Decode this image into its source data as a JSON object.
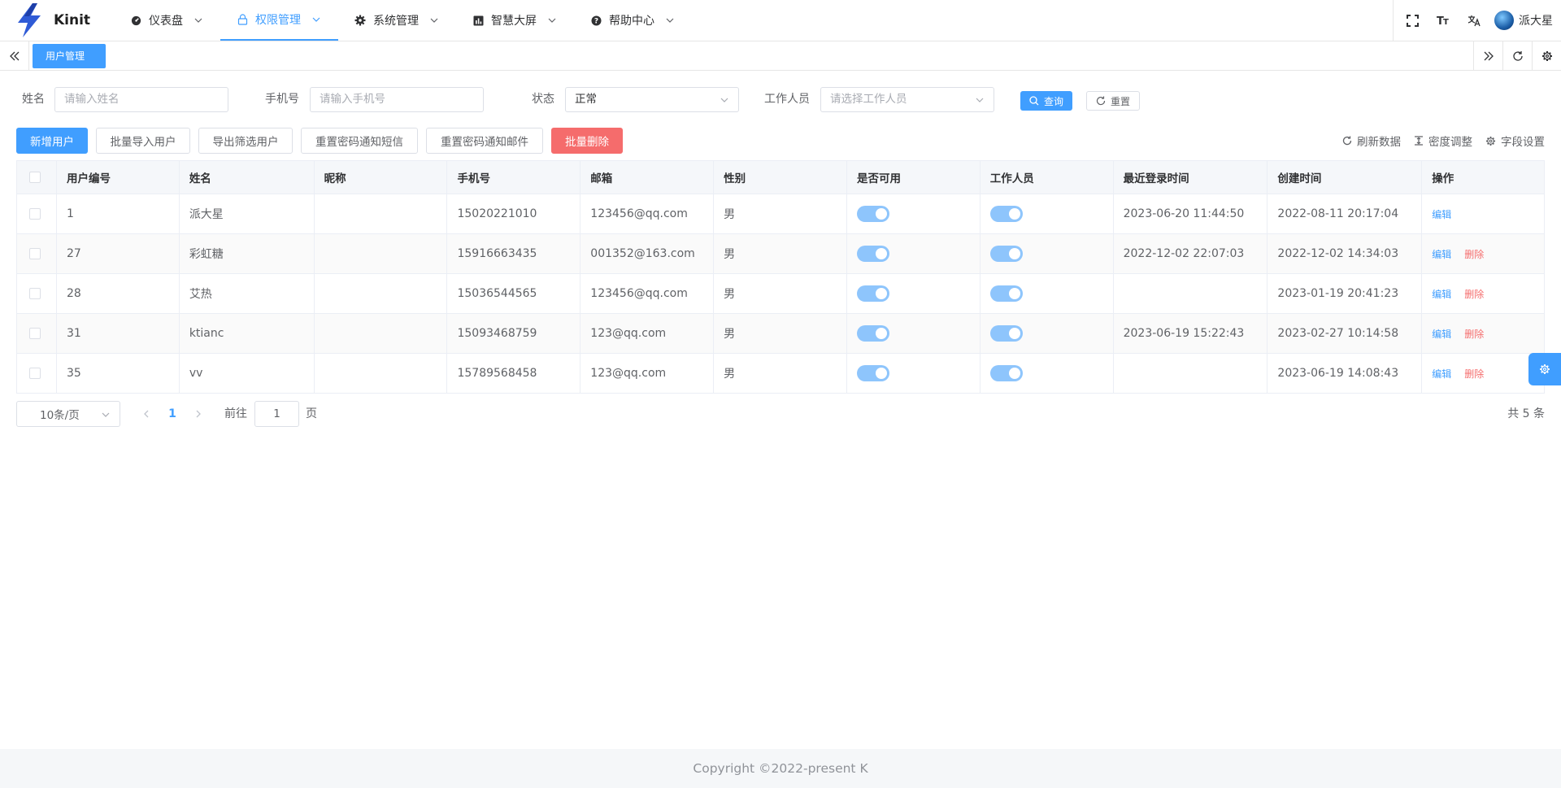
{
  "app": {
    "name": "Kinit"
  },
  "menu": [
    {
      "label": "仪表盘",
      "icon": "dashboard-icon",
      "active": false
    },
    {
      "label": "权限管理",
      "icon": "lock-icon",
      "active": true
    },
    {
      "label": "系统管理",
      "icon": "gear-icon",
      "active": false
    },
    {
      "label": "智慧大屏",
      "icon": "chart-icon",
      "active": false
    },
    {
      "label": "帮助中心",
      "icon": "help-icon",
      "active": false
    }
  ],
  "user": {
    "name": "派大星"
  },
  "tags": {
    "active": "用户管理"
  },
  "search": {
    "name_label": "姓名",
    "name_placeholder": "请输入姓名",
    "phone_label": "手机号",
    "phone_placeholder": "请输入手机号",
    "status_label": "状态",
    "status_value": "正常",
    "staff_label": "工作人员",
    "staff_placeholder": "请选择工作人员",
    "query": "查询",
    "reset": "重置"
  },
  "toolbar": {
    "add": "新增用户",
    "import": "批量导入用户",
    "export": "导出筛选用户",
    "reset_sms": "重置密码通知短信",
    "reset_mail": "重置密码通知邮件",
    "batch_delete": "批量删除",
    "refresh": "刷新数据",
    "density": "密度调整",
    "columns": "字段设置"
  },
  "table": {
    "headers": [
      "用户编号",
      "姓名",
      "昵称",
      "手机号",
      "邮箱",
      "性别",
      "是否可用",
      "工作人员",
      "最近登录时间",
      "创建时间",
      "操作"
    ],
    "edit": "编辑",
    "delete": "删除",
    "rows": [
      {
        "id": "1",
        "name": "派大星",
        "nick": "",
        "phone": "15020221010",
        "email": "123456@qq.com",
        "gender": "男",
        "active": true,
        "staff": true,
        "last_login": "2023-06-20 11:44:50",
        "created": "2022-08-11 20:17:04"
      },
      {
        "id": "27",
        "name": "彩虹糖",
        "nick": "",
        "phone": "15916663435",
        "email": "001352@163.com",
        "gender": "男",
        "active": true,
        "staff": true,
        "last_login": "2022-12-02 22:07:03",
        "created": "2022-12-02 14:34:03"
      },
      {
        "id": "28",
        "name": "艾热",
        "nick": "",
        "phone": "15036544565",
        "email": "123456@qq.com",
        "gender": "男",
        "active": true,
        "staff": true,
        "last_login": "",
        "created": "2023-01-19 20:41:23"
      },
      {
        "id": "31",
        "name": "ktianc",
        "nick": "",
        "phone": "15093468759",
        "email": "123@qq.com",
        "gender": "男",
        "active": true,
        "staff": true,
        "last_login": "2023-06-19 15:22:43",
        "created": "2023-02-27 10:14:58"
      },
      {
        "id": "35",
        "name": "vv",
        "nick": "",
        "phone": "15789568458",
        "email": "123@qq.com",
        "gender": "男",
        "active": true,
        "staff": true,
        "last_login": "",
        "created": "2023-06-19 14:08:43"
      }
    ]
  },
  "pagination": {
    "page_size": "10条/页",
    "current": "1",
    "goto_label": "前往",
    "goto_value": "1",
    "page_unit": "页",
    "total": "共 5 条"
  },
  "footer": {
    "copyright": "Copyright ©2022-present K"
  }
}
